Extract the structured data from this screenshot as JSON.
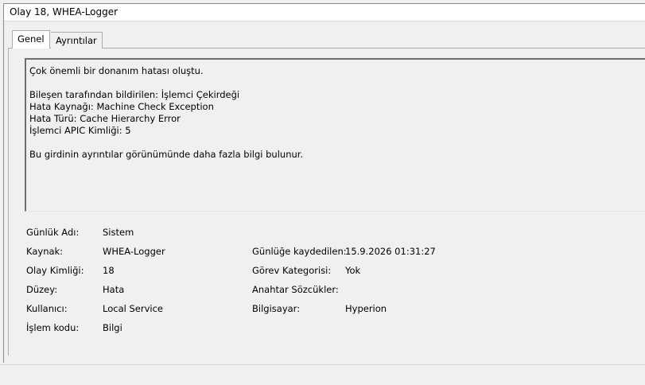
{
  "window": {
    "title": "Olay 18, WHEA-Logger"
  },
  "tabs": [
    {
      "label": "Genel",
      "active": true
    },
    {
      "label": "Ayrıntılar",
      "active": false
    }
  ],
  "description": {
    "lines": [
      "Çok önemli bir donanım hatası oluştu.",
      "",
      "Bileşen tarafından bildirilen: İşlemci Çekirdeği",
      "Hata Kaynağı: Machine Check Exception",
      "Hata Türü: Cache Hierarchy Error",
      "İşlemci APIC Kimliği: 5",
      "",
      "Bu girdinin ayrıntılar görünümünde daha fazla bilgi bulunur."
    ]
  },
  "fields": {
    "log_name": {
      "label": "Günlük Adı:",
      "value": "Sistem"
    },
    "source": {
      "label": "Kaynak:",
      "value": "WHEA-Logger"
    },
    "event_id": {
      "label": "Olay Kimliği:",
      "value": "18"
    },
    "level": {
      "label": "Düzey:",
      "value": "Hata"
    },
    "user": {
      "label": "Kullanıcı:",
      "value": "Local Service"
    },
    "opcode": {
      "label": "İşlem kodu:",
      "value": "Bilgi"
    },
    "logged": {
      "label": "Günlüğe kaydedilen:",
      "value": "15.9.2026 01:31:27"
    },
    "task_category": {
      "label": "Görev Kategorisi:",
      "value": "Yok"
    },
    "keywords": {
      "label": "Anahtar Sözcükler:",
      "value": ""
    },
    "computer": {
      "label": "Bilgisayar:",
      "value": "Hyperion"
    }
  }
}
